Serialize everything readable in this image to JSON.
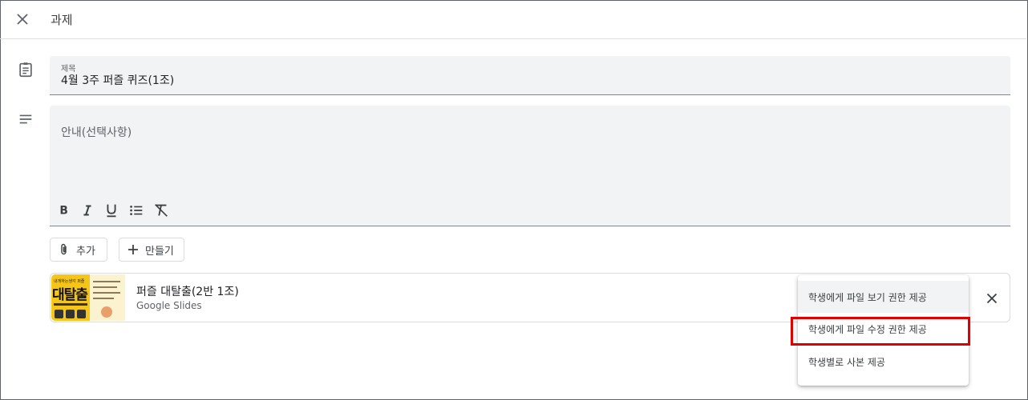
{
  "header": {
    "title": "과제",
    "close_icon": "close-icon"
  },
  "title_field": {
    "label": "제목",
    "value": "4월 3주 퍼즐 퀴즈(1조)"
  },
  "description_field": {
    "placeholder": "안내(선택사항)"
  },
  "format_toolbar": [
    "bold-icon",
    "italic-icon",
    "underline-icon",
    "bulleted-list-icon",
    "clear-format-icon"
  ],
  "actions": {
    "add_label": "추가",
    "create_label": "만들기"
  },
  "attachment": {
    "title": "퍼즐 대탈출(2반 1조)",
    "subtitle": "Google Slides",
    "thumbnail_text": "대탈출",
    "thumbnail_top_text": "내게하는생각 퍼즐"
  },
  "share_menu": {
    "items": [
      "학생에게 파일 보기 권한 제공",
      "학생에게 파일 수정 권한 제공",
      "학생별로 사본 제공"
    ]
  },
  "colors": {
    "accent_red": "#e00000",
    "field_bg": "#f1f3f4"
  }
}
